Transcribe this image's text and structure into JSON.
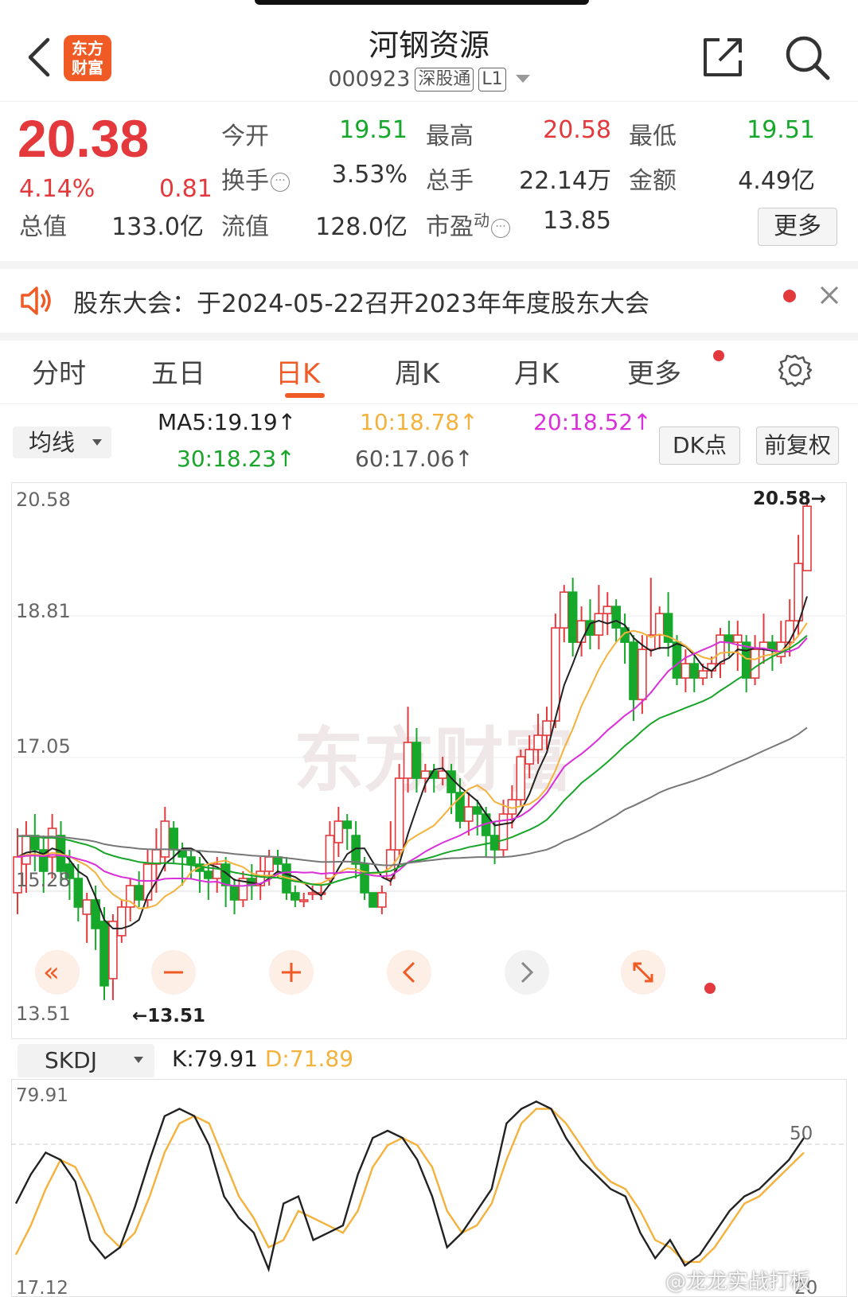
{
  "header": {
    "logo_line1": "东方",
    "logo_line2": "财富",
    "stock_name": "河钢资源",
    "stock_code": "000923",
    "tag1": "深股通",
    "tag2": "L1"
  },
  "quote": {
    "price": "20.38",
    "change_pct": "4.14%",
    "change_abs": "0.81",
    "items": [
      {
        "label": "今开",
        "value": "19.51"
      },
      {
        "label": "最高",
        "value": "20.58"
      },
      {
        "label": "最低",
        "value": "19.51"
      },
      {
        "label": "换手",
        "value": "3.53%"
      },
      {
        "label": "总手",
        "value": "22.14万"
      },
      {
        "label": "金额",
        "value": "4.49亿"
      },
      {
        "label": "总值",
        "value": "133.0亿"
      },
      {
        "label": "流值",
        "value": "128.0亿"
      },
      {
        "label": "市盈",
        "label_sup": "动",
        "value": "13.85"
      }
    ],
    "more_label": "更多",
    "colors": {
      "up": "#e4393c",
      "down": "#16a82a"
    }
  },
  "notice": {
    "text": "股东大会：于2024-05-22召开2023年年度股东大会"
  },
  "tabs": [
    "分时",
    "五日",
    "日K",
    "周K",
    "月K",
    "更多"
  ],
  "active_tab": "日K",
  "ma_row": {
    "selector": "均线",
    "ma5": "MA5:19.19↑",
    "ma10": "10:18.78↑",
    "ma20": "20:18.52↑",
    "ma30": "30:18.23↑",
    "ma60": "60:17.06↑",
    "dk_button": "DK点",
    "adjust_button": "前复权",
    "colors": {
      "ma5": "#222222",
      "ma10": "#f4b23c",
      "ma20": "#d930d9",
      "ma30": "#18a52a",
      "ma60": "#777777"
    }
  },
  "chart_data": [
    {
      "type": "candlestick",
      "y_ticks": [
        "20.58",
        "18.81",
        "17.05",
        "15.28",
        "13.51"
      ],
      "ylim": [
        13.51,
        20.58
      ],
      "max_annotation": "20.58→",
      "min_annotation": "←13.51",
      "candles": [
        [
          15.0,
          15.5,
          14.7,
          15.9
        ],
        [
          15.4,
          15.8,
          15.0,
          16.0
        ],
        [
          15.8,
          15.6,
          15.3,
          16.1
        ],
        [
          15.6,
          15.3,
          15.0,
          15.8
        ],
        [
          15.5,
          15.9,
          15.2,
          16.1
        ],
        [
          15.8,
          15.3,
          15.1,
          16.0
        ],
        [
          15.4,
          15.2,
          14.9,
          15.6
        ],
        [
          15.2,
          14.8,
          14.6,
          15.4
        ],
        [
          14.7,
          14.9,
          14.3,
          15.0
        ],
        [
          14.9,
          14.5,
          14.2,
          15.1
        ],
        [
          14.6,
          13.7,
          13.5,
          14.8
        ],
        [
          13.8,
          14.6,
          13.5,
          14.7
        ],
        [
          14.4,
          14.8,
          14.3,
          14.9
        ],
        [
          14.8,
          15.1,
          14.6,
          15.2
        ],
        [
          15.1,
          14.9,
          14.8,
          15.3
        ],
        [
          14.9,
          15.4,
          14.8,
          15.6
        ],
        [
          15.4,
          15.6,
          15.0,
          15.9
        ],
        [
          15.5,
          16.0,
          15.3,
          16.2
        ],
        [
          15.9,
          15.6,
          15.4,
          16.0
        ],
        [
          15.6,
          15.5,
          15.1,
          15.7
        ],
        [
          15.5,
          15.4,
          15.2,
          15.6
        ],
        [
          15.4,
          15.3,
          15.0,
          15.5
        ],
        [
          15.3,
          15.2,
          14.9,
          15.4
        ],
        [
          15.2,
          15.4,
          15.0,
          15.5
        ],
        [
          15.4,
          15.1,
          14.8,
          15.5
        ],
        [
          15.1,
          14.9,
          14.7,
          15.2
        ],
        [
          14.9,
          15.2,
          14.8,
          15.3
        ],
        [
          15.2,
          15.1,
          14.9,
          15.4
        ],
        [
          15.1,
          15.3,
          14.9,
          15.5
        ],
        [
          15.3,
          15.5,
          15.1,
          15.6
        ],
        [
          15.5,
          15.4,
          15.2,
          15.6
        ],
        [
          15.4,
          15.0,
          14.9,
          15.5
        ],
        [
          15.0,
          14.9,
          14.8,
          15.1
        ],
        [
          14.9,
          14.9,
          14.8,
          15.0
        ],
        [
          15.0,
          15.0,
          14.9,
          15.1
        ],
        [
          15.0,
          15.0,
          14.9,
          15.1
        ],
        [
          15.2,
          15.8,
          15.1,
          16.0
        ],
        [
          15.7,
          16.0,
          15.5,
          16.2
        ],
        [
          16.0,
          15.9,
          15.6,
          16.1
        ],
        [
          15.8,
          15.4,
          15.2,
          16.0
        ],
        [
          15.4,
          15.0,
          14.9,
          15.5
        ],
        [
          15.0,
          14.8,
          14.8,
          15.0
        ],
        [
          14.8,
          15.0,
          14.7,
          15.1
        ],
        [
          15.2,
          15.6,
          15.1,
          16.0
        ],
        [
          15.6,
          16.6,
          15.5,
          16.8
        ],
        [
          16.6,
          17.1,
          16.4,
          17.6
        ],
        [
          17.1,
          16.6,
          16.4,
          17.3
        ],
        [
          16.6,
          16.7,
          16.4,
          16.8
        ],
        [
          16.7,
          16.6,
          16.4,
          16.8
        ],
        [
          16.6,
          16.7,
          16.5,
          16.9
        ],
        [
          16.7,
          16.4,
          16.1,
          16.8
        ],
        [
          16.4,
          16.0,
          15.9,
          16.6
        ],
        [
          16.0,
          16.2,
          15.8,
          16.4
        ],
        [
          16.2,
          16.1,
          15.8,
          16.3
        ],
        [
          16.1,
          15.8,
          15.5,
          16.2
        ],
        [
          15.8,
          15.6,
          15.4,
          16.0
        ],
        [
          15.6,
          16.1,
          15.5,
          16.3
        ],
        [
          16.1,
          16.3,
          15.9,
          16.5
        ],
        [
          16.3,
          16.9,
          16.2,
          17.0
        ],
        [
          16.8,
          17.0,
          16.6,
          17.2
        ],
        [
          17.0,
          17.2,
          16.8,
          17.5
        ],
        [
          17.2,
          17.4,
          17.0,
          17.6
        ],
        [
          17.4,
          18.7,
          17.3,
          18.9
        ],
        [
          18.7,
          19.2,
          18.5,
          19.3
        ],
        [
          19.2,
          18.5,
          18.3,
          19.4
        ],
        [
          18.5,
          18.8,
          18.3,
          19.0
        ],
        [
          18.8,
          18.6,
          18.4,
          19.1
        ],
        [
          18.6,
          18.9,
          18.4,
          19.3
        ],
        [
          18.9,
          19.0,
          18.6,
          19.2
        ],
        [
          19.0,
          18.7,
          18.5,
          19.1
        ],
        [
          18.7,
          18.5,
          18.2,
          18.9
        ],
        [
          18.5,
          17.7,
          17.4,
          18.6
        ],
        [
          17.7,
          18.4,
          17.5,
          18.6
        ],
        [
          18.4,
          18.6,
          18.3,
          19.4
        ],
        [
          18.6,
          18.9,
          18.4,
          19.0
        ],
        [
          18.9,
          18.5,
          18.3,
          19.2
        ],
        [
          18.5,
          18.0,
          17.9,
          18.6
        ],
        [
          18.0,
          18.2,
          17.8,
          18.4
        ],
        [
          18.2,
          18.0,
          17.8,
          18.3
        ],
        [
          18.0,
          18.1,
          17.9,
          18.2
        ],
        [
          18.1,
          18.2,
          18.0,
          18.3
        ],
        [
          18.2,
          18.6,
          18.0,
          18.7
        ],
        [
          18.6,
          18.5,
          18.3,
          18.8
        ],
        [
          18.5,
          18.6,
          18.1,
          18.8
        ],
        [
          18.5,
          18.0,
          17.8,
          18.6
        ],
        [
          18.0,
          18.4,
          17.9,
          18.6
        ],
        [
          18.4,
          18.5,
          18.2,
          18.9
        ],
        [
          18.5,
          18.4,
          18.1,
          18.6
        ],
        [
          18.3,
          18.5,
          18.2,
          18.8
        ],
        [
          18.5,
          18.8,
          18.3,
          19.1
        ],
        [
          18.8,
          19.6,
          18.6,
          20.0
        ],
        [
          19.5,
          20.4,
          19.5,
          20.58
        ]
      ]
    },
    {
      "type": "line",
      "y_ticks": [
        "79.91",
        "50",
        "17.12",
        "20"
      ],
      "ylim": [
        17.12,
        79.91
      ],
      "series_k": [
        48,
        56,
        62,
        60,
        54,
        38,
        33,
        36,
        47,
        60,
        72,
        74,
        72,
        64,
        50,
        44,
        40,
        30,
        48,
        50,
        38,
        40,
        42,
        56,
        66,
        68,
        66,
        60,
        50,
        36,
        40,
        46,
        52,
        70,
        74,
        76,
        74,
        66,
        60,
        56,
        52,
        50,
        40,
        33,
        38,
        31,
        34,
        40,
        46,
        50,
        52,
        56,
        60,
        66
      ],
      "series_d": [
        34,
        42,
        52,
        60,
        58,
        50,
        40,
        36,
        40,
        50,
        62,
        70,
        72,
        70,
        60,
        50,
        44,
        36,
        38,
        46,
        44,
        42,
        40,
        46,
        58,
        64,
        66,
        64,
        58,
        46,
        40,
        42,
        48,
        60,
        70,
        74,
        74,
        70,
        64,
        58,
        54,
        52,
        46,
        38,
        36,
        32,
        32,
        36,
        42,
        48,
        50,
        54,
        58,
        62
      ]
    }
  ],
  "kdj": {
    "selector": "SKDJ",
    "k_label": "K:79.91",
    "d_label": "D:71.89",
    "colors": {
      "k": "#222222",
      "d": "#f4b23c"
    }
  },
  "watermark": "@龙龙实战打板"
}
